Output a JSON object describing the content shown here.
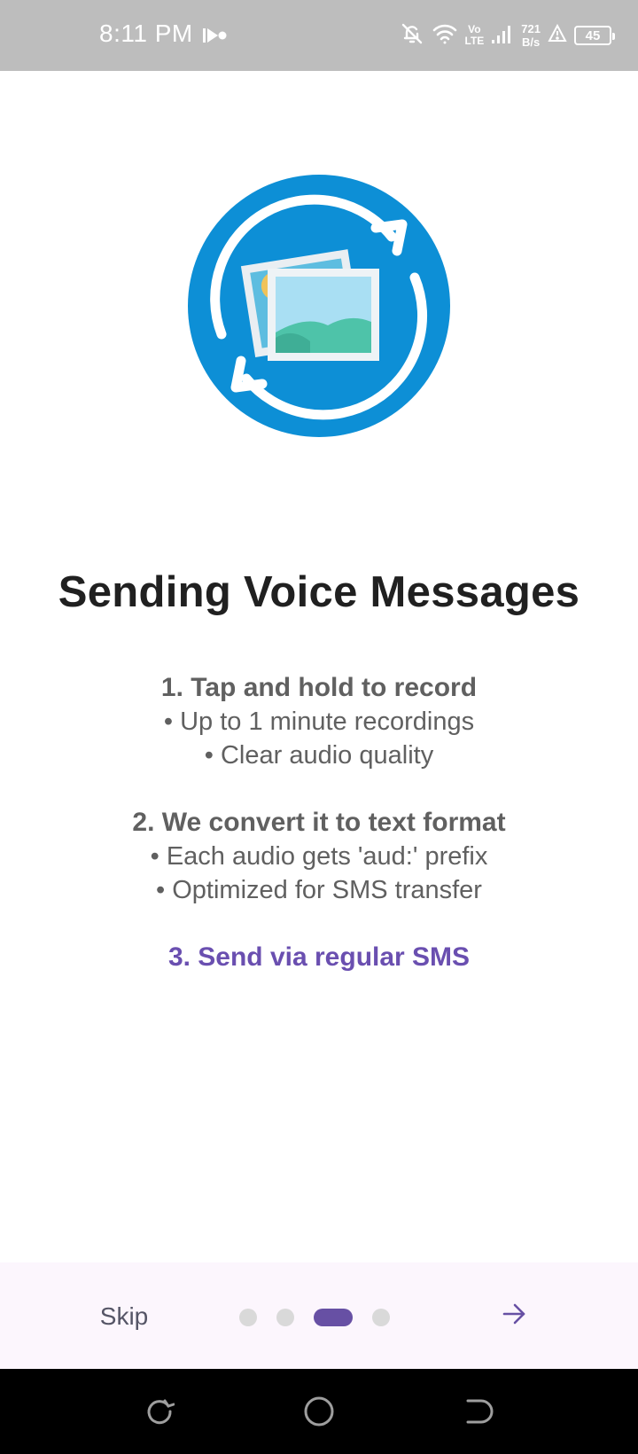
{
  "status_bar": {
    "time": "8:11 PM",
    "net_speed_value": "721",
    "net_speed_unit": "B/s",
    "volte_top": "Vo",
    "volte_bottom": "LTE",
    "battery": "45",
    "icons": [
      "recording-icon",
      "bell-off-icon",
      "wifi-icon",
      "signal-icon",
      "alert-icon",
      "battery-icon"
    ]
  },
  "hero": {
    "icon": "image-sync-icon",
    "circle_color": "#0d8fd6"
  },
  "content": {
    "title": "Sending Voice Messages",
    "step1_head": "1. Tap and hold to record",
    "step1_bullets": [
      "• Up to 1 minute recordings",
      "• Clear audio quality"
    ],
    "step2_head": "2. We convert it to text format",
    "step2_bullets": [
      "• Each audio gets 'aud:' prefix",
      "• Optimized for SMS transfer"
    ],
    "step3": "3. Send via regular SMS",
    "accent_color": "#6a4fb0"
  },
  "bottom_bar": {
    "skip_label": "Skip",
    "page_count": 4,
    "active_page": 3,
    "next_icon": "arrow-right-icon"
  },
  "nav_bar": {
    "icons": [
      "recent-apps-icon",
      "home-icon",
      "back-icon"
    ]
  }
}
